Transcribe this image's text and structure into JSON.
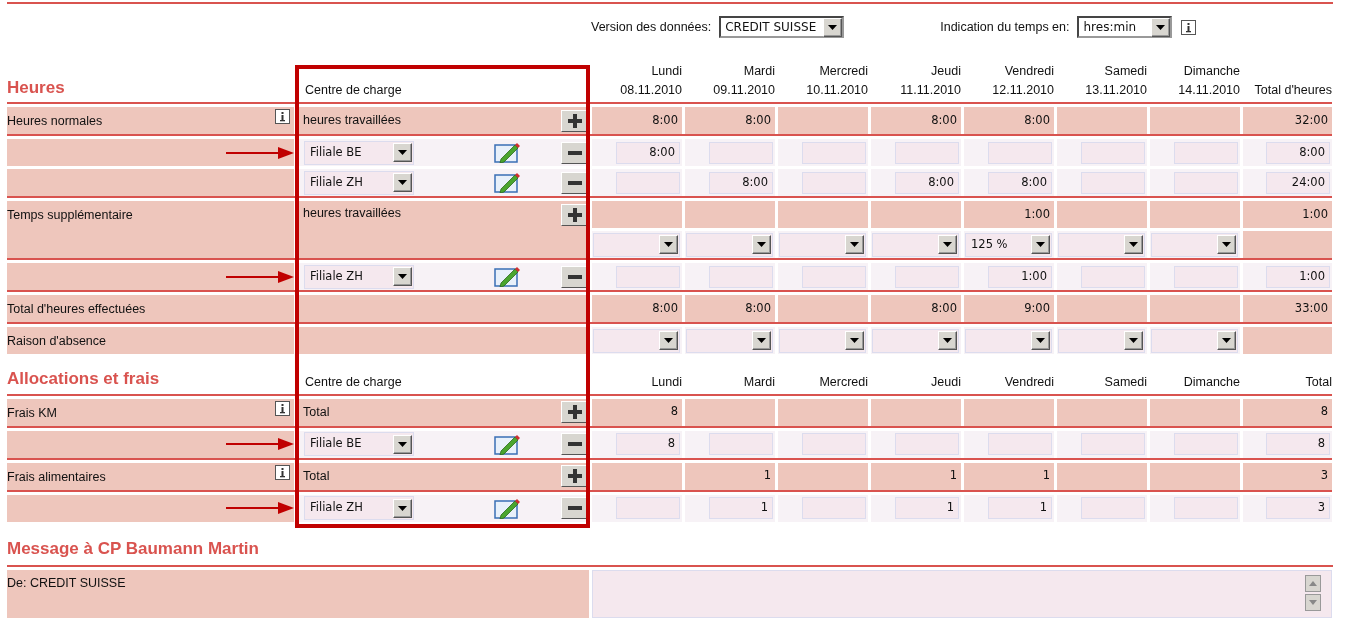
{
  "top_bar": {
    "version_label": "Version des données:",
    "version_value": "CREDIT SUISSE",
    "time_label": "Indication du temps en:",
    "time_value": "hres:min"
  },
  "sections": [
    {
      "title": "Heures",
      "header": {
        "cost_center": "Centre de charge",
        "days": [
          {
            "day": "Lundi",
            "date": "08.11.2010"
          },
          {
            "day": "Mardi",
            "date": "09.11.2010"
          },
          {
            "day": "Mercredi",
            "date": "10.11.2010"
          },
          {
            "day": "Jeudi",
            "date": "11.11.2010"
          },
          {
            "day": "Vendredi",
            "date": "12.11.2010"
          },
          {
            "day": "Samedi",
            "date": "13.11.2010"
          },
          {
            "day": "Dimanche",
            "date": "14.11.2010"
          }
        ],
        "total": "Total d'heures"
      },
      "rows": [
        {
          "kind": "sum",
          "label": "Heures normales",
          "info": true,
          "cost_center": "heures travaillées",
          "values": {
            "mon": "8:00",
            "tue": "8:00",
            "thu": "8:00",
            "fri": "8:00"
          },
          "total": "32:00"
        },
        {
          "kind": "entry",
          "arrow": true,
          "cost_center": "Filiale BE",
          "values": {
            "mon": "8:00"
          },
          "total": "8:00"
        },
        {
          "kind": "entry",
          "arrow": false,
          "cost_center": "Filiale ZH",
          "values": {
            "tue": "8:00",
            "thu": "8:00",
            "fri": "8:00"
          },
          "total": "24:00"
        },
        {
          "kind": "overtime",
          "label": "Temps supplémentaire",
          "info": false,
          "cost_center": "heures travaillées",
          "values": {
            "fri": "1:00"
          },
          "total": "1:00",
          "rates": {
            "fri": "125 %"
          }
        },
        {
          "kind": "entry",
          "arrow": true,
          "cost_center": "Filiale ZH",
          "values": {
            "fri": "1:00"
          },
          "total": "1:00"
        },
        {
          "kind": "total",
          "label": "Total d'heures effectuées",
          "info": false,
          "values": {
            "mon": "8:00",
            "tue": "8:00",
            "thu": "8:00",
            "fri": "9:00"
          },
          "total": "33:00"
        },
        {
          "kind": "absence",
          "label": "Raison d'absence",
          "info": false
        }
      ]
    },
    {
      "title": "Allocations et frais",
      "header": {
        "cost_center": "Centre de charge",
        "days": [
          {
            "day": "Lundi"
          },
          {
            "day": "Mardi"
          },
          {
            "day": "Mercredi"
          },
          {
            "day": "Jeudi"
          },
          {
            "day": "Vendredi"
          },
          {
            "day": "Samedi"
          },
          {
            "day": "Dimanche"
          }
        ],
        "total": "Total"
      },
      "rows": [
        {
          "kind": "sum",
          "label": "Frais KM",
          "info": true,
          "cost_center": "Total",
          "values": {
            "mon": "8"
          },
          "total": "8"
        },
        {
          "kind": "entry",
          "arrow": true,
          "cost_center": "Filiale BE",
          "values": {
            "mon": "8"
          },
          "total": "8"
        },
        {
          "kind": "sum",
          "label": "Frais alimentaires",
          "info": true,
          "cost_center": "Total",
          "values": {
            "tue": "1",
            "thu": "1",
            "fri": "1"
          },
          "total": "3"
        },
        {
          "kind": "entry",
          "arrow": true,
          "cost_center": "Filiale ZH",
          "values": {
            "tue": "1",
            "thu": "1",
            "fri": "1"
          },
          "total": "3"
        }
      ]
    }
  ],
  "message": {
    "title": "Message à CP Baumann Martin",
    "from": "De: CREDIT SUISSE"
  }
}
